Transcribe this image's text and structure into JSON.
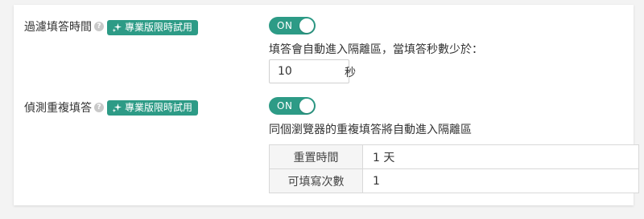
{
  "settings": [
    {
      "label": "過濾填答時間",
      "badge": "專業版限時試用",
      "toggle": "ON",
      "description": "填答會自動進入隔離區，當填答秒數少於：",
      "input_value": "10",
      "unit": "秒"
    },
    {
      "label": "偵測重複填答",
      "badge": "專業版限時試用",
      "toggle": "ON",
      "description": "同個瀏覽器的重複填答將自動進入隔離區",
      "table": [
        {
          "key": "重置時間",
          "value": "1 天"
        },
        {
          "key": "可填寫次數",
          "value": "1"
        }
      ]
    }
  ],
  "colors": {
    "accent": "#2d9b86"
  },
  "icons": {
    "help": "question-circle-icon",
    "badge": "sparkle-icon"
  }
}
